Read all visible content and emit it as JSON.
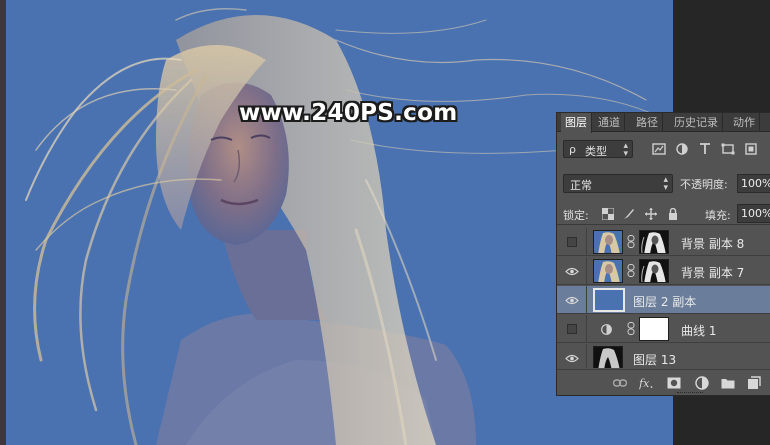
{
  "watermark": {
    "text": "www.240PS.com"
  },
  "layers_panel": {
    "tabs": [
      {
        "label": "图层",
        "active": true
      },
      {
        "label": "通道",
        "active": false
      },
      {
        "label": "路径",
        "active": false
      },
      {
        "label": "历史记录",
        "active": false
      },
      {
        "label": "动作",
        "active": false
      }
    ],
    "filter": {
      "kind_label": "类型",
      "search_glyph": "ρ"
    },
    "blend_mode": "正常",
    "opacity_label": "不透明度:",
    "opacity_value": "100%",
    "lock_label": "锁定:",
    "fill_label": "填充:",
    "fill_value": "100%",
    "layers": [
      {
        "name": "背景 副本 8",
        "visible": false,
        "has_mask": true,
        "selected": false
      },
      {
        "name": "背景 副本 7",
        "visible": true,
        "has_mask": true,
        "selected": false
      },
      {
        "name": "图层 2 副本",
        "visible": true,
        "has_mask": false,
        "selected": true,
        "fill_color": "#4a72b0"
      },
      {
        "name": "曲线 1",
        "visible": false,
        "adjustment": true,
        "selected": false
      },
      {
        "name": "图层 13",
        "visible": true,
        "has_mask": false,
        "selected": false
      }
    ],
    "bottom_icons": [
      "link-icon",
      "fx-icon",
      "add-mask-icon",
      "adjustment-icon",
      "group-folder-icon",
      "new-layer-icon"
    ],
    "colors": {
      "panel_bg": "#535353",
      "selected_row": "#6a7d9a",
      "canvas_blue": "#4a72b0"
    }
  }
}
